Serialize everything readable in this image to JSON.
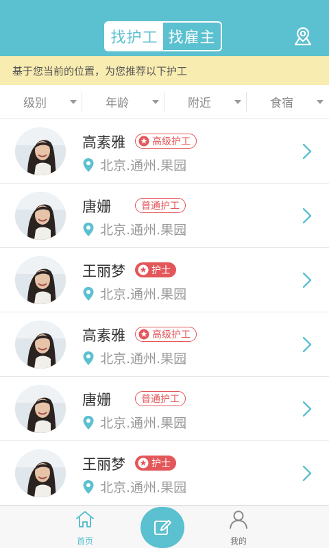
{
  "header": {
    "tabs": [
      {
        "label": "找护工",
        "active": true
      },
      {
        "label": "找雇主",
        "active": false
      }
    ],
    "location_icon": "map-pin-location-icon"
  },
  "notice": {
    "text": "基于您当前的位置，为您推荐以下护工"
  },
  "filters": [
    {
      "label": "级别"
    },
    {
      "label": "年龄"
    },
    {
      "label": "附近"
    },
    {
      "label": "食宿"
    }
  ],
  "caregivers": [
    {
      "name": "高素雅",
      "badge": "高级护工",
      "badge_style": "outline-star",
      "location": "北京.通州.果园"
    },
    {
      "name": "唐姗",
      "badge": "普通护工",
      "badge_style": "outline",
      "location": "北京.通州.果园"
    },
    {
      "name": "王丽梦",
      "badge": "护士",
      "badge_style": "filled-star",
      "location": "北京.通州.果园"
    },
    {
      "name": "高素雅",
      "badge": "高级护工",
      "badge_style": "outline-star",
      "location": "北京.通州.果园"
    },
    {
      "name": "唐姗",
      "badge": "普通护工",
      "badge_style": "outline",
      "location": "北京.通州.果园"
    },
    {
      "name": "王丽梦",
      "badge": "护士",
      "badge_style": "filled-star",
      "location": "北京.通州.果园"
    }
  ],
  "bottom_nav": {
    "home": {
      "label": "首页",
      "icon": "home-icon",
      "active": true
    },
    "compose": {
      "icon": "edit-pencil-icon"
    },
    "me": {
      "label": "我的",
      "icon": "user-icon",
      "active": false
    }
  },
  "colors": {
    "accent": "#5bc0cf",
    "notice_bg": "#f8ecb0",
    "badge_red": "#e3565a"
  }
}
